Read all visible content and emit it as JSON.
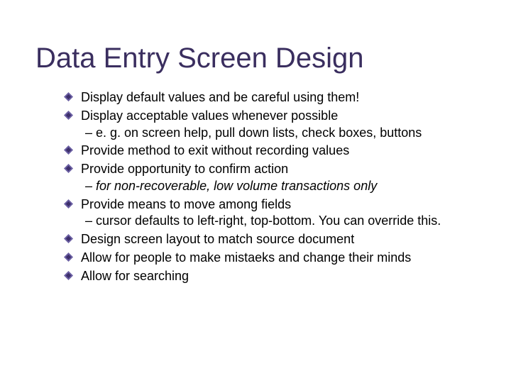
{
  "slide": {
    "title": "Data Entry Screen Design",
    "bullets": [
      {
        "text": "Display default values and be careful using them!",
        "sub": null,
        "subStyle": "plain"
      },
      {
        "text": "Display acceptable values whenever possible",
        "sub": "– e. g. on screen help, pull down lists, check boxes, buttons",
        "subStyle": "plain"
      },
      {
        "text": "Provide method to exit without recording values",
        "sub": null,
        "subStyle": "plain"
      },
      {
        "text": "Provide opportunity to confirm action",
        "sub": "– for non-recoverable, low volume transactions only",
        "subStyle": "italic"
      },
      {
        "text": "Provide means to move among fields",
        "sub": "– cursor defaults to left-right, top-bottom. You can override this.",
        "subStyle": "plain"
      },
      {
        "text": "Design screen layout to match source document",
        "sub": null,
        "subStyle": "plain"
      },
      {
        "text": "Allow for people to make mistaeks and change their minds",
        "sub": null,
        "subStyle": "plain"
      },
      {
        "text": "Allow for searching",
        "sub": null,
        "subStyle": "plain"
      }
    ],
    "icons": {
      "bullet": "diamond-icon"
    },
    "colors": {
      "title": "#3a2e5f",
      "bulletOuter": "#6b5fa3",
      "bulletInner": "#3d2f6b",
      "text": "#000000",
      "background": "#ffffff"
    }
  }
}
